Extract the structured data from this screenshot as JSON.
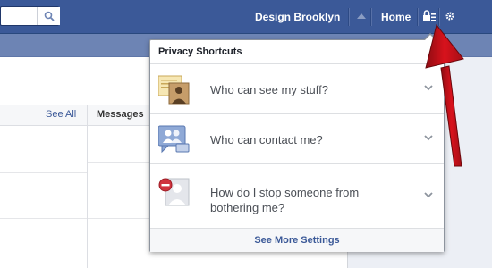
{
  "topbar": {
    "user_name": "Design Brooklyn",
    "home_label": "Home"
  },
  "left_panel": {
    "see_all_label": "See All",
    "messages_title": "Messages"
  },
  "privacy_popup": {
    "title": "Privacy Shortcuts",
    "items": [
      {
        "label": "Who can see my stuff?",
        "icon": "notepad-person-icon"
      },
      {
        "label": "Who can contact me?",
        "icon": "chat-people-icon"
      },
      {
        "label": "How do I stop someone from bothering me?",
        "icon": "block-person-icon"
      }
    ],
    "footer_link": "See More Settings"
  },
  "colors": {
    "brand_blue": "#3b5998",
    "arrow_red": "#c8101a"
  }
}
